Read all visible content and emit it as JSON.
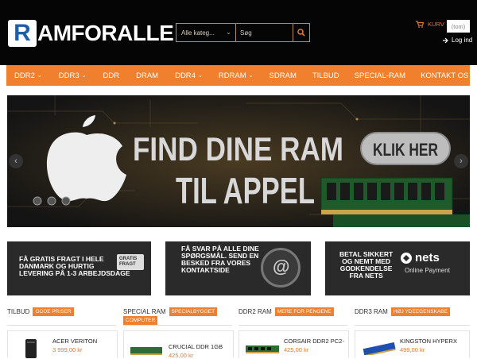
{
  "header": {
    "logo_letter": "R",
    "logo_text": "AMFORALLE",
    "category_select": "Alle kateg...",
    "search_placeholder": "Søg",
    "cart_label": "KURV",
    "cart_empty": "(tom)",
    "login_label": "Log ind"
  },
  "nav": {
    "items": [
      {
        "label": "DDR2",
        "dropdown": true
      },
      {
        "label": "DDR3",
        "dropdown": true
      },
      {
        "label": "DDR",
        "dropdown": false
      },
      {
        "label": "DRAM",
        "dropdown": false
      },
      {
        "label": "DDR4",
        "dropdown": true
      },
      {
        "label": "RDRAM",
        "dropdown": true
      },
      {
        "label": "SDRAM",
        "dropdown": false
      },
      {
        "label": "TILBUD",
        "dropdown": false
      },
      {
        "label": "SPECIAL-RAM",
        "dropdown": false
      },
      {
        "label": "KONTAKT OS",
        "dropdown": false
      }
    ]
  },
  "hero": {
    "line1": "FIND DINE RAM",
    "line2": "TIL APPEL",
    "cta": "KLIK HER",
    "prev_arrow": "‹",
    "next_arrow": "›"
  },
  "banners": [
    {
      "text": "FÅ GRATIS FRAGT I HELE\nDANMARK OG HURTIG\nLEVERING PÅ 1-3 ARBEJDSDAGE",
      "icon_text": "GRATIS\nFRAGT"
    },
    {
      "text": "FÅ SVAR PÅ ALLE DINE\nSPØRGSMÅL. SEND EN\nBESKED FRA VORES\nKONTAKTSIDE",
      "icon_text": "@"
    },
    {
      "text": "BETAL SIKKERT\nOG NEMT MED\nGODKENDELSE\nFRA NETS",
      "brand": "nets",
      "brand_sub": "Online Payment"
    }
  ],
  "categories": [
    {
      "title": "TILBUD",
      "badge": "GODE PRISER"
    },
    {
      "title": "SPECIAL RAM",
      "badge": "SPECIALBYGGET",
      "badge2": "COMPUTER"
    },
    {
      "title": "DDR2 RAM",
      "badge": "MERE FOR PENGENE"
    },
    {
      "title": "DDR3 RAM",
      "badge": "HØJ YDEEGENSKABE"
    }
  ],
  "products": [
    {
      "name": "ACER VERITON",
      "price": "3 999,00 kr"
    },
    {
      "name": "CRUCIAL DDR 1GB",
      "price": "425,00 kr"
    },
    {
      "name": "CORSAIR DDR2 PC2-",
      "price": "425,00 kr"
    },
    {
      "name": "KINGSTON HYPERX",
      "price": "499,00 kr"
    }
  ],
  "colors": {
    "accent": "#f07f2e",
    "header_bg": "#050505",
    "logo_blue": "#1f5fa8"
  }
}
